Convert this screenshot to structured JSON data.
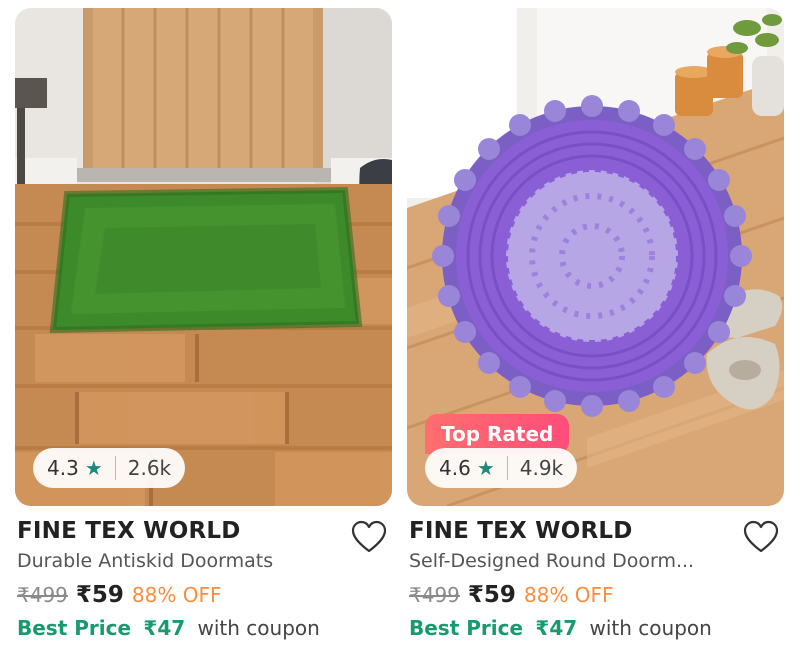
{
  "products": [
    {
      "brand": "FINE TEX WORLD",
      "title": "Durable Antiskid Doormats",
      "rating": "4.3",
      "rating_count": "2.6k",
      "mrp": "₹499",
      "price": "₹59",
      "discount": "88% OFF",
      "best_price_label": "Best Price",
      "best_price": "₹47",
      "best_price_suffix": "with coupon",
      "badge": ""
    },
    {
      "brand": "FINE TEX WORLD",
      "title": "Self-Designed Round Doorm...",
      "rating": "4.6",
      "rating_count": "4.9k",
      "mrp": "₹499",
      "price": "₹59",
      "discount": "88% OFF",
      "best_price_label": "Best Price",
      "best_price": "₹47",
      "best_price_suffix": "with coupon",
      "badge": "Top Rated"
    }
  ],
  "colors": {
    "star": "#1b8a7a",
    "best_price": "#179b6e",
    "discount": "#ff8c3a",
    "badge_gradient": [
      "#ff6f6f",
      "#ff4d7a"
    ]
  },
  "icons": {
    "star": "★",
    "wishlist": "heart-outline-icon"
  }
}
